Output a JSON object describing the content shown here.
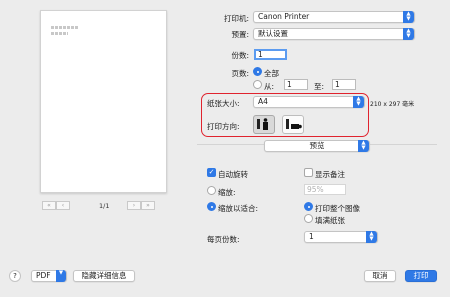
{
  "preview": {
    "page_count": "1/1",
    "nav": {
      "first": "«",
      "prev": "‹",
      "next": "›",
      "last": "»"
    }
  },
  "printer": {
    "label": "打印机:",
    "value": "Canon Printer"
  },
  "preset": {
    "label": "预置:",
    "value": "默认设置"
  },
  "copies": {
    "label": "份数:",
    "value": "1"
  },
  "pages": {
    "label": "页数:",
    "all_label": "全部",
    "from_label": "从:",
    "from_value": "1",
    "to_label": "至:",
    "to_value": "1"
  },
  "paper_size": {
    "label": "纸张大小:",
    "value": "A4",
    "dimensions": "210 x 297 毫米"
  },
  "orientation": {
    "label": "打印方向:",
    "selected": "portrait"
  },
  "section_select": {
    "value": "预览"
  },
  "options": {
    "auto_rotate": "自动旋转",
    "show_notes": "显示备注",
    "scale_label": "缩放:",
    "scale_value": "95%",
    "scale_to_fit": "缩放以适合:",
    "print_entire_image": "打印整个图像",
    "fill_paper": "填满纸张",
    "copies_per_page_label": "每页份数:",
    "copies_per_page_value": "1"
  },
  "footer": {
    "help": "?",
    "pdf": "PDF",
    "hide_details": "隐藏详细信息",
    "cancel": "取消",
    "print": "打印"
  },
  "colors": {
    "accent": "#2f79e6",
    "highlight": "#e0232e"
  }
}
